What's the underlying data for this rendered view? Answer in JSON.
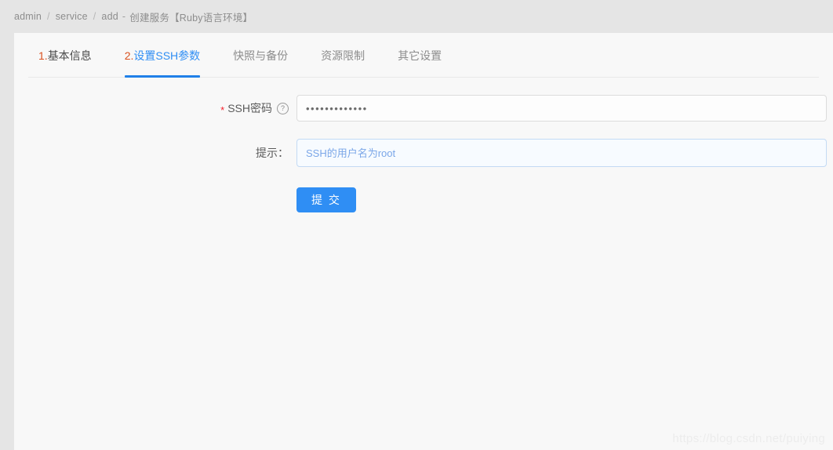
{
  "breadcrumb": {
    "root": "admin",
    "section": "service",
    "action": "add",
    "separator": "/",
    "dash": "-",
    "title": "创建服务【Ruby语言环境】"
  },
  "tabs": [
    {
      "index": "1.",
      "label": "基本信息",
      "state": "step"
    },
    {
      "index": "2.",
      "label": "设置SSH参数",
      "state": "active"
    },
    {
      "index": "",
      "label": "快照与备份",
      "state": "normal"
    },
    {
      "index": "",
      "label": "资源限制",
      "state": "normal"
    },
    {
      "index": "",
      "label": "其它设置",
      "state": "normal"
    }
  ],
  "form": {
    "password_row": {
      "required_mark": "*",
      "label": "SSH密码",
      "help_icon": "question-circle-icon",
      "value": "•••••••••••••",
      "placeholder": ""
    },
    "hint_row": {
      "label": "提示：",
      "value": "",
      "placeholder": "SSH的用户名为root"
    },
    "submit": {
      "label": "提 交"
    }
  },
  "watermark": {
    "text": "https://blog.csdn.net/puiying"
  },
  "colors": {
    "accent": "#2f8ef4",
    "step_index": "#d9501e",
    "required": "#f5222d",
    "page_bg": "#e5e5e5",
    "card_bg": "#f8f8f8"
  }
}
